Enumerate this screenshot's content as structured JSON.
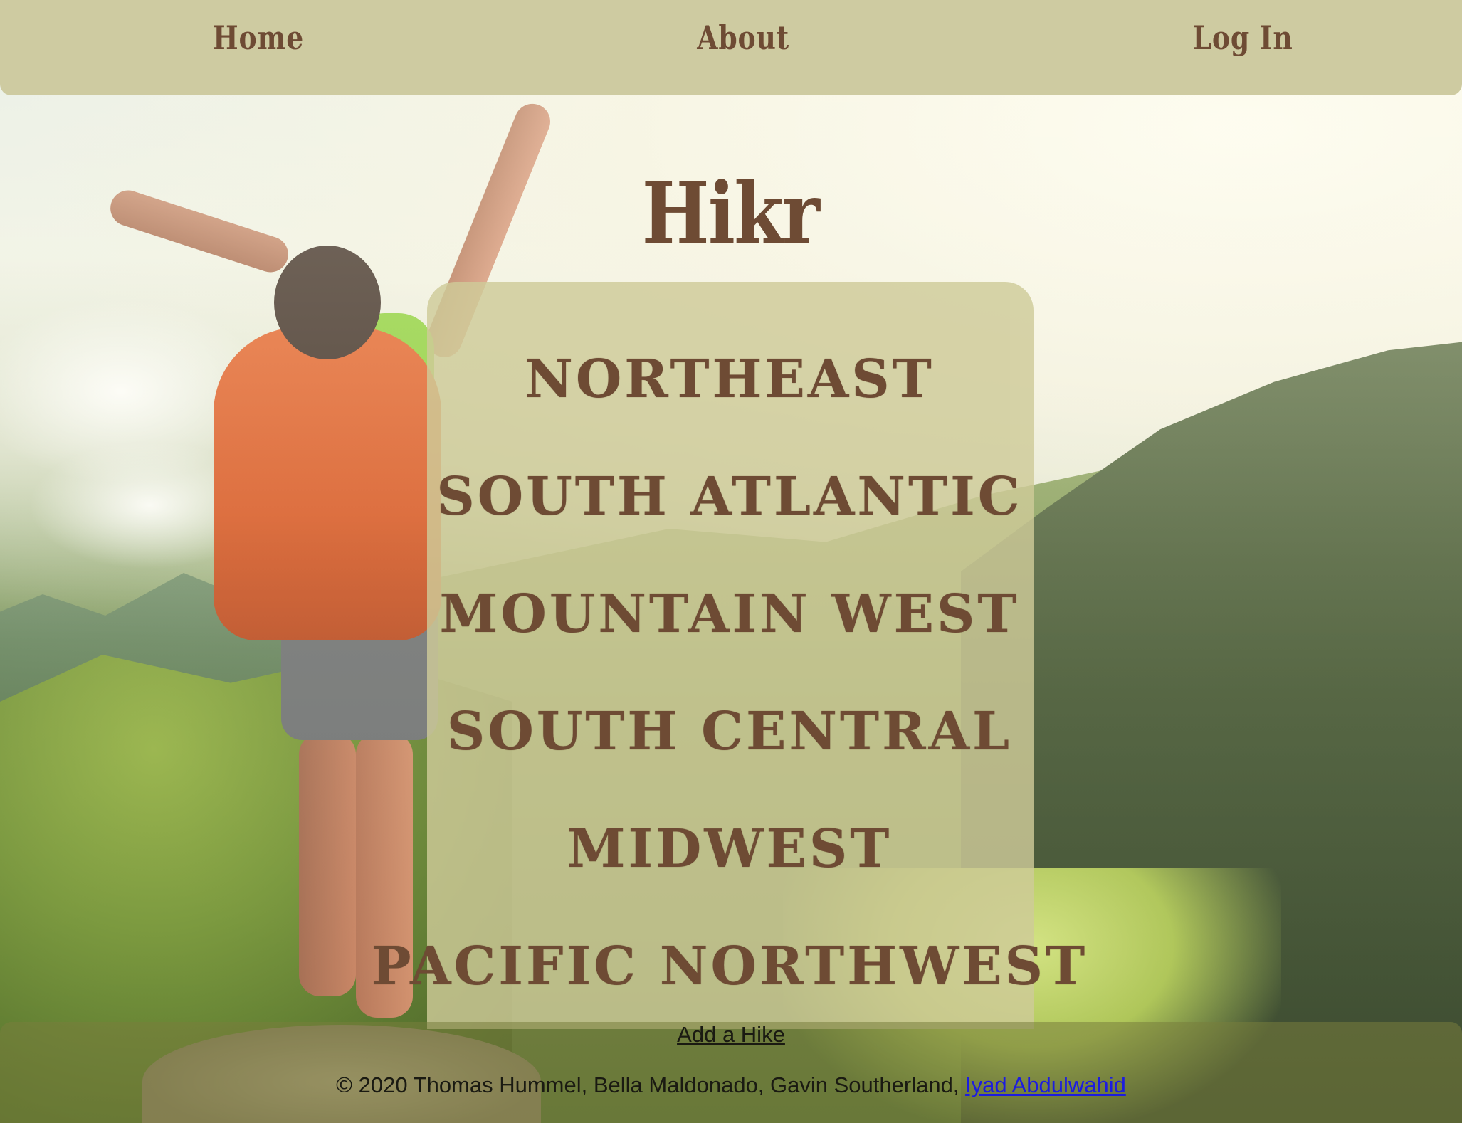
{
  "nav": {
    "home": "Home",
    "about": "About",
    "login": "Log In"
  },
  "logo": "Hikr",
  "regions": [
    "NORTHEAST",
    "SOUTH ATLANTIC",
    "MOUNTAIN WEST",
    "SOUTH CENTRAL",
    "MIDWEST",
    "PACIFIC NORTHWEST"
  ],
  "footer": {
    "add_hike": "Add a Hike",
    "copyright_prefix": "© 2020 Thomas Hummel, Bella Maldonado, Gavin Southerland, ",
    "last_author": "Iyad Abdulwahid"
  },
  "colors": {
    "nav_text": "#6e4b34",
    "nav_bg": "#ccc99e",
    "panel_bg": "#cecb98",
    "link_blue": "#1c1ce0"
  }
}
